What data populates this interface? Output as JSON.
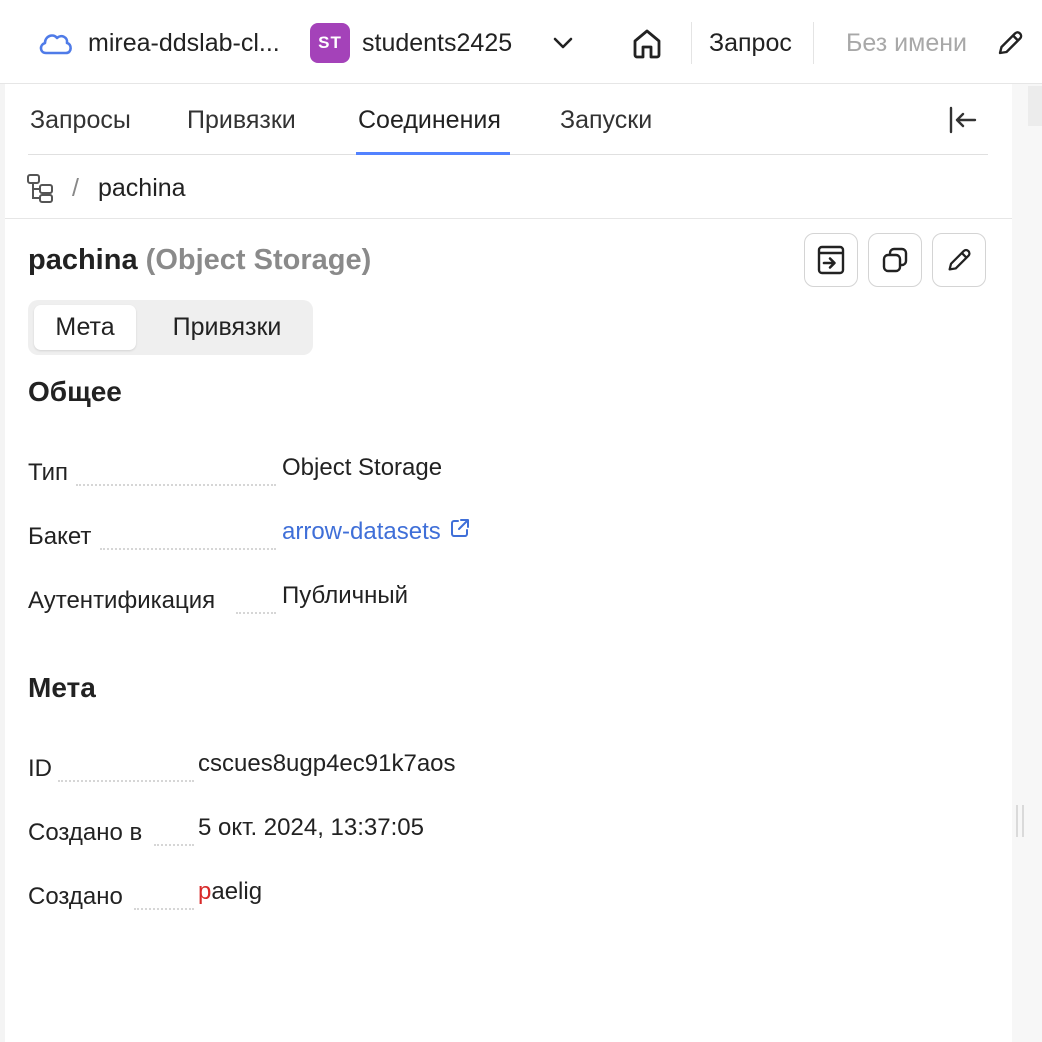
{
  "header": {
    "cloud_name": "mirea-ddslab-cl...",
    "avatar_initials": "ST",
    "avatar_color": "#a442b9",
    "folder_name": "students2425",
    "query_label": "Запрос",
    "query_name_placeholder": "Без имени"
  },
  "tabs": [
    {
      "label": "Запросы",
      "active": false
    },
    {
      "label": "Привязки",
      "active": false
    },
    {
      "label": "Соединения",
      "active": true
    },
    {
      "label": "Запуски",
      "active": false
    }
  ],
  "breadcrumb": {
    "separator": "/",
    "current": "pachina"
  },
  "connection": {
    "name": "pachina",
    "type_suffix": "(Object Storage)"
  },
  "segment": [
    {
      "label": "Мета",
      "active": true
    },
    {
      "label": "Привязки",
      "active": false
    }
  ],
  "general": {
    "title": "Общее",
    "type_label": "Тип",
    "type_value": "Object Storage",
    "bucket_label": "Бакет",
    "bucket_value": "arrow-datasets",
    "auth_label": "Аутентификация",
    "auth_value": "Публичный"
  },
  "meta": {
    "title": "Мета",
    "id_label": "ID",
    "id_value": "cscues8ugp4ec91k7aos",
    "created_at_label": "Создано в",
    "created_at_value": "5 окт. 2024, 13:37:05",
    "created_by_label": "Создано",
    "created_by_first": "p",
    "created_by_rest": "aelig"
  },
  "colors": {
    "accent": "#5282ff",
    "link": "#3f6fd8",
    "muted": "#8a8a8a",
    "user_mark": "#d82a2a"
  },
  "icons": [
    "cloud-icon",
    "chevron-down-icon",
    "home-icon",
    "pencil-icon",
    "collapse-panel-icon",
    "folder-tree-icon",
    "sign-in-icon",
    "copy-icon",
    "edit-icon",
    "external-link-icon"
  ]
}
